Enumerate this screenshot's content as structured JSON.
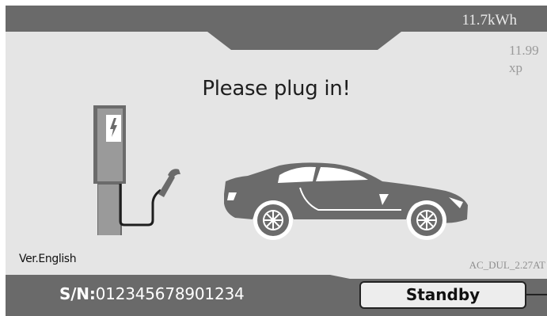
{
  "header": {
    "energy": "11.7kWh"
  },
  "tariff": {
    "price": "11.99",
    "unit": "xp"
  },
  "main": {
    "message": "Please plug in!"
  },
  "info": {
    "version": "Ver.English",
    "firmware": "AC_DUL_2.27AT"
  },
  "footer": {
    "serial_label": "S/N:",
    "serial_number": "012345678901234",
    "status": "Standby"
  },
  "icons": {
    "charger": "charging-station-icon",
    "cable": "charging-cable-icon",
    "car": "car-icon"
  },
  "colors": {
    "dark_gray": "#6a6a6a",
    "panel": "#e5e5e5",
    "illustration": "#6b6b6b"
  }
}
